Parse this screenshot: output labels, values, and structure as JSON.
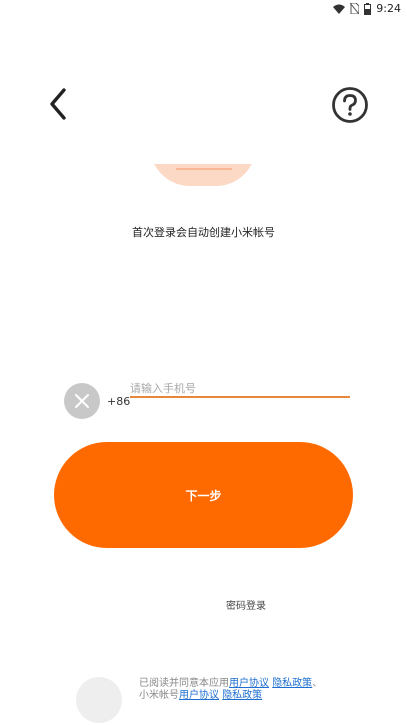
{
  "status_bar": {
    "time": "9:24",
    "icons": [
      "wifi-icon",
      "no-sim-icon",
      "battery-icon"
    ]
  },
  "header": {
    "back_icon": "chevron-left-icon",
    "help_icon": "question-circle-icon"
  },
  "login": {
    "subtitle": "首次登录会自动创建小米帐号",
    "country_code": "+86",
    "phone_placeholder": "请输入手机号",
    "phone_value": "",
    "next_label": "下一步",
    "password_login_label": "密码登录"
  },
  "agreement": {
    "prefix": "已阅读并同意本应用",
    "user_agreement_1": "用户协议",
    "privacy_policy_1": "隐私政策",
    "mid": "、小米帐号",
    "user_agreement_2": "用户协议",
    "privacy_policy_2": "隐私政策"
  },
  "colors": {
    "accent": "#ff6a00",
    "input_underline": "#e8863b",
    "link": "#1f6fd0",
    "logo_tint": "#fcd9c5"
  }
}
